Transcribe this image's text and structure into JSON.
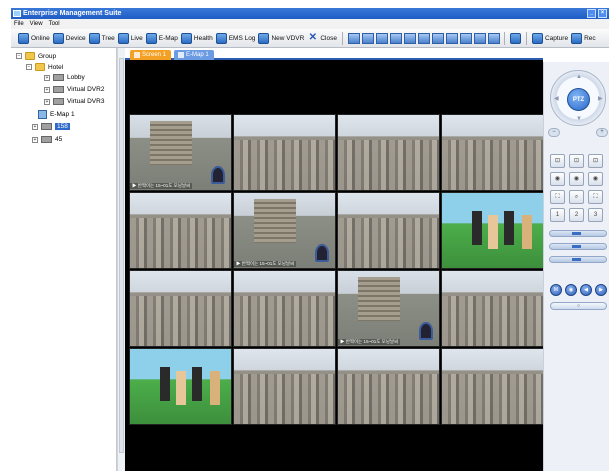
{
  "window": {
    "title": "Enterprise Management Suite",
    "min_label": "_",
    "close_label": "×"
  },
  "menu": [
    "File",
    "View",
    "Tool"
  ],
  "toolbar": {
    "buttons": [
      "Online",
      "Device",
      "Tree",
      "Live",
      "E-Map",
      "Health",
      "EMS Log",
      "New VDVR",
      "Close"
    ],
    "right_buttons": [
      "Capture",
      "Rec"
    ]
  },
  "tree": {
    "group": "Group",
    "hotel": "Hotel",
    "lobby": "Lobby",
    "dvr2": "Virtual DVR2",
    "dvr3": "Virtual DVR3",
    "emap": "E-Map 1",
    "node158": "158",
    "node45": "45",
    "exp_minus": "−",
    "exp_plus": "+"
  },
  "tabs": [
    "Screen 1",
    "E-Map 1"
  ],
  "grid": {
    "tiles": [
      "bldg",
      "city",
      "city",
      "city",
      "city",
      "bldg",
      "city",
      "cartoon",
      "city",
      "city",
      "bldg",
      "city",
      "cartoon",
      "city",
      "city",
      "city"
    ],
    "overlay_text": "▶ 반짝이는 15~01도 모닝날씨"
  },
  "ptz": {
    "label": "PTZ",
    "zoom_minus": "−",
    "zoom_plus": "+",
    "up": "▲",
    "down": "▼",
    "left": "◀",
    "right": "▶",
    "grid_buttons": [
      "⊡",
      "⊡",
      "⊡",
      "◉",
      "◉",
      "◉",
      "⛶",
      "⌕",
      "⛶",
      "1",
      "2",
      "3"
    ],
    "play_buttons": [
      "M",
      "◉",
      "◀",
      "▶"
    ],
    "bottom_label": "○"
  }
}
